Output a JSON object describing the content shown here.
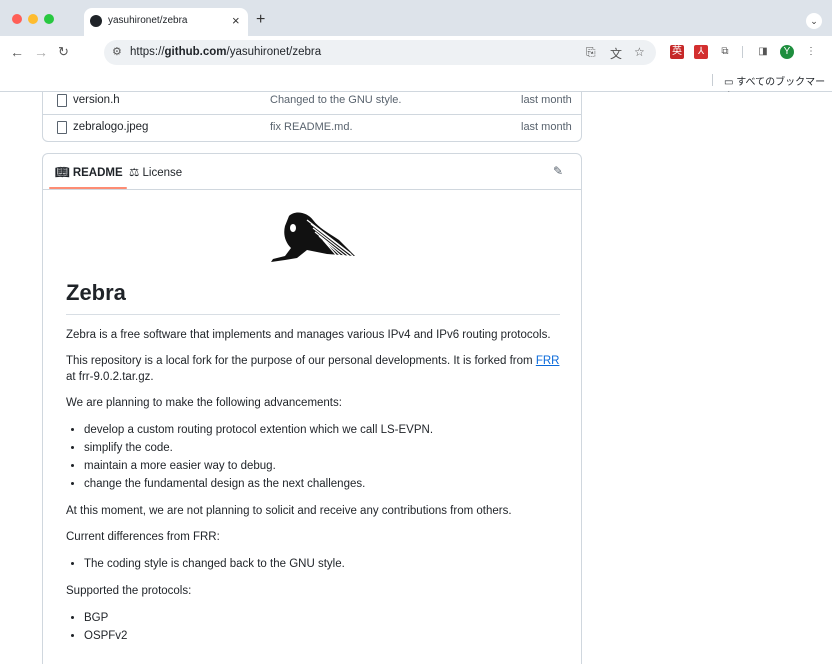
{
  "browser": {
    "tab_title": "yasuhironet/zebra",
    "tab_close": "×",
    "new_tab": "+",
    "url_scheme": "https://",
    "url_host": "github.com",
    "url_path": "/yasuhironet/zebra",
    "bookmark_folder": "すべてのブックマーク",
    "profile_initial": "Y"
  },
  "files": [
    {
      "name": "version.h",
      "message": "Changed to the GNU style.",
      "age": "last month"
    },
    {
      "name": "zebralogo.jpeg",
      "message": "fix README.md.",
      "age": "last month"
    }
  ],
  "readme": {
    "tab_readme": "README",
    "tab_license": "License",
    "title": "Zebra",
    "p1": "Zebra is a free software that implements and manages various IPv4 and IPv6 routing protocols.",
    "p2_before": "This repository is a local fork for the purpose of our personal developments. It is forked from ",
    "p2_link": "FRR",
    "p2_after": " at frr-9.0.2.tar.gz.",
    "p3": "We are planning to make the following advancements:",
    "plans": [
      "develop a custom routing protocol extention which we call LS-EVPN.",
      "simplify the code.",
      "maintain a more easier way to debug.",
      "change the fundamental design as the next challenges."
    ],
    "p4": "At this moment, we are not planning to solicit and receive any contributions from others.",
    "p5": "Current differences from FRR:",
    "differences": [
      "The coding style is changed back to the GNU style."
    ],
    "p6": "Supported the protocols:",
    "protocols": [
      "BGP",
      "OSPFv2"
    ]
  }
}
